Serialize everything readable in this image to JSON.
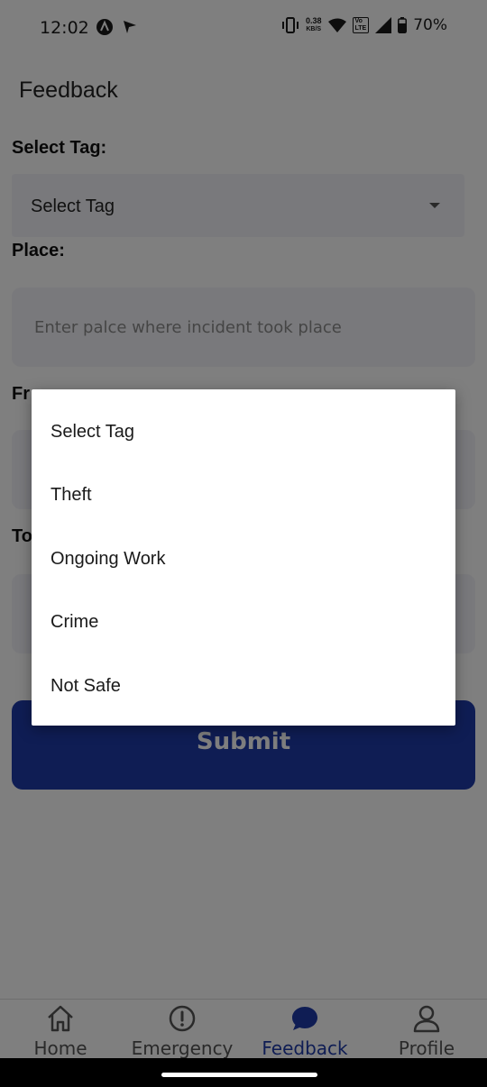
{
  "status_bar": {
    "time": "12:02",
    "net_speed_value": "0.38",
    "net_speed_unit": "KB/S",
    "volte_top": "Vo",
    "volte_bottom": "LTE",
    "battery": "70%"
  },
  "page": {
    "title": "Feedback"
  },
  "form": {
    "tag_label": "Select Tag:",
    "tag_selected": "Select Tag",
    "place_label": "Place:",
    "place_placeholder": "Enter palce where incident took place",
    "from_label": "Fr",
    "to_label": "To",
    "submit_label": "Submit"
  },
  "dropdown": {
    "options": [
      "Select Tag",
      "Theft",
      "Ongoing Work",
      "Crime",
      "Not Safe"
    ]
  },
  "bottom_nav": {
    "items": [
      {
        "label": "Home",
        "icon": "home-icon"
      },
      {
        "label": "Emergency",
        "icon": "alert-circle-icon"
      },
      {
        "label": "Feedback",
        "icon": "chat-bubble-icon",
        "active": true
      },
      {
        "label": "Profile",
        "icon": "person-icon"
      }
    ]
  },
  "colors": {
    "primary": "#1e3aa8",
    "field_bg": "#f3f3f8",
    "scrim": "rgba(0,0,0,0.5)"
  }
}
